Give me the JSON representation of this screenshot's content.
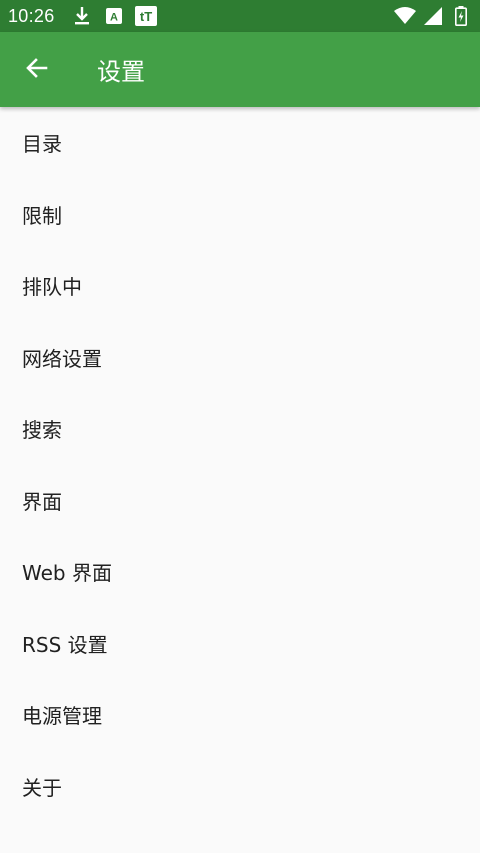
{
  "status_bar": {
    "time": "10:26",
    "notification_icons": [
      "download-icon",
      "a-badge-icon",
      "transmission-icon"
    ],
    "system_icons": [
      "wifi-icon",
      "signal-icon",
      "battery-icon"
    ],
    "a_badge_text": "A",
    "tt_badge_text": "tT"
  },
  "app_bar": {
    "title": "设置",
    "back_icon": "arrow-left-icon",
    "color": "#43a047",
    "status_color": "#2e7d32"
  },
  "settings": {
    "items": [
      {
        "label": "目录"
      },
      {
        "label": "限制"
      },
      {
        "label": "排队中"
      },
      {
        "label": "网络设置"
      },
      {
        "label": "搜索"
      },
      {
        "label": "界面"
      },
      {
        "label": "Web 界面"
      },
      {
        "label": "RSS 设置"
      },
      {
        "label": "电源管理"
      },
      {
        "label": "关于"
      }
    ]
  }
}
